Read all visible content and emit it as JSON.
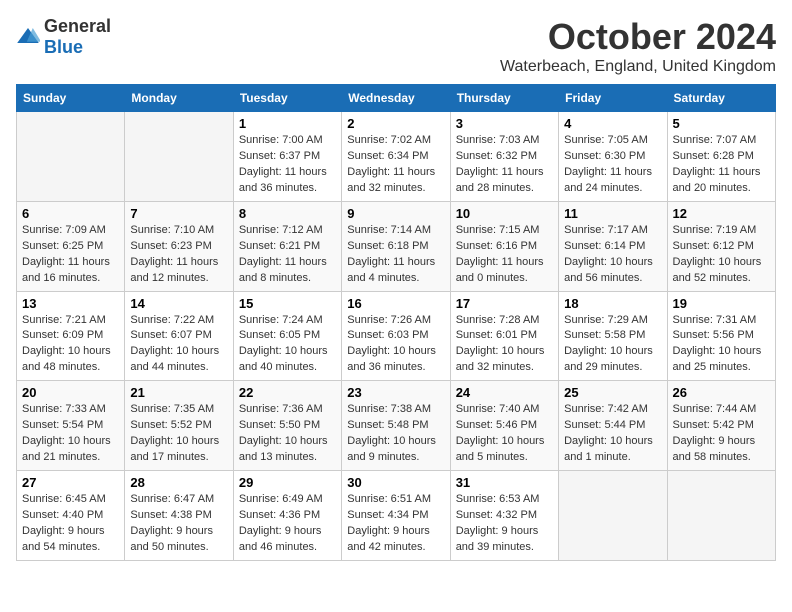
{
  "logo": {
    "general": "General",
    "blue": "Blue"
  },
  "title": "October 2024",
  "location": "Waterbeach, England, United Kingdom",
  "headers": [
    "Sunday",
    "Monday",
    "Tuesday",
    "Wednesday",
    "Thursday",
    "Friday",
    "Saturday"
  ],
  "weeks": [
    [
      {
        "day": "",
        "content": ""
      },
      {
        "day": "",
        "content": ""
      },
      {
        "day": "1",
        "content": "Sunrise: 7:00 AM\nSunset: 6:37 PM\nDaylight: 11 hours and 36 minutes."
      },
      {
        "day": "2",
        "content": "Sunrise: 7:02 AM\nSunset: 6:34 PM\nDaylight: 11 hours and 32 minutes."
      },
      {
        "day": "3",
        "content": "Sunrise: 7:03 AM\nSunset: 6:32 PM\nDaylight: 11 hours and 28 minutes."
      },
      {
        "day": "4",
        "content": "Sunrise: 7:05 AM\nSunset: 6:30 PM\nDaylight: 11 hours and 24 minutes."
      },
      {
        "day": "5",
        "content": "Sunrise: 7:07 AM\nSunset: 6:28 PM\nDaylight: 11 hours and 20 minutes."
      }
    ],
    [
      {
        "day": "6",
        "content": "Sunrise: 7:09 AM\nSunset: 6:25 PM\nDaylight: 11 hours and 16 minutes."
      },
      {
        "day": "7",
        "content": "Sunrise: 7:10 AM\nSunset: 6:23 PM\nDaylight: 11 hours and 12 minutes."
      },
      {
        "day": "8",
        "content": "Sunrise: 7:12 AM\nSunset: 6:21 PM\nDaylight: 11 hours and 8 minutes."
      },
      {
        "day": "9",
        "content": "Sunrise: 7:14 AM\nSunset: 6:18 PM\nDaylight: 11 hours and 4 minutes."
      },
      {
        "day": "10",
        "content": "Sunrise: 7:15 AM\nSunset: 6:16 PM\nDaylight: 11 hours and 0 minutes."
      },
      {
        "day": "11",
        "content": "Sunrise: 7:17 AM\nSunset: 6:14 PM\nDaylight: 10 hours and 56 minutes."
      },
      {
        "day": "12",
        "content": "Sunrise: 7:19 AM\nSunset: 6:12 PM\nDaylight: 10 hours and 52 minutes."
      }
    ],
    [
      {
        "day": "13",
        "content": "Sunrise: 7:21 AM\nSunset: 6:09 PM\nDaylight: 10 hours and 48 minutes."
      },
      {
        "day": "14",
        "content": "Sunrise: 7:22 AM\nSunset: 6:07 PM\nDaylight: 10 hours and 44 minutes."
      },
      {
        "day": "15",
        "content": "Sunrise: 7:24 AM\nSunset: 6:05 PM\nDaylight: 10 hours and 40 minutes."
      },
      {
        "day": "16",
        "content": "Sunrise: 7:26 AM\nSunset: 6:03 PM\nDaylight: 10 hours and 36 minutes."
      },
      {
        "day": "17",
        "content": "Sunrise: 7:28 AM\nSunset: 6:01 PM\nDaylight: 10 hours and 32 minutes."
      },
      {
        "day": "18",
        "content": "Sunrise: 7:29 AM\nSunset: 5:58 PM\nDaylight: 10 hours and 29 minutes."
      },
      {
        "day": "19",
        "content": "Sunrise: 7:31 AM\nSunset: 5:56 PM\nDaylight: 10 hours and 25 minutes."
      }
    ],
    [
      {
        "day": "20",
        "content": "Sunrise: 7:33 AM\nSunset: 5:54 PM\nDaylight: 10 hours and 21 minutes."
      },
      {
        "day": "21",
        "content": "Sunrise: 7:35 AM\nSunset: 5:52 PM\nDaylight: 10 hours and 17 minutes."
      },
      {
        "day": "22",
        "content": "Sunrise: 7:36 AM\nSunset: 5:50 PM\nDaylight: 10 hours and 13 minutes."
      },
      {
        "day": "23",
        "content": "Sunrise: 7:38 AM\nSunset: 5:48 PM\nDaylight: 10 hours and 9 minutes."
      },
      {
        "day": "24",
        "content": "Sunrise: 7:40 AM\nSunset: 5:46 PM\nDaylight: 10 hours and 5 minutes."
      },
      {
        "day": "25",
        "content": "Sunrise: 7:42 AM\nSunset: 5:44 PM\nDaylight: 10 hours and 1 minute."
      },
      {
        "day": "26",
        "content": "Sunrise: 7:44 AM\nSunset: 5:42 PM\nDaylight: 9 hours and 58 minutes."
      }
    ],
    [
      {
        "day": "27",
        "content": "Sunrise: 6:45 AM\nSunset: 4:40 PM\nDaylight: 9 hours and 54 minutes."
      },
      {
        "day": "28",
        "content": "Sunrise: 6:47 AM\nSunset: 4:38 PM\nDaylight: 9 hours and 50 minutes."
      },
      {
        "day": "29",
        "content": "Sunrise: 6:49 AM\nSunset: 4:36 PM\nDaylight: 9 hours and 46 minutes."
      },
      {
        "day": "30",
        "content": "Sunrise: 6:51 AM\nSunset: 4:34 PM\nDaylight: 9 hours and 42 minutes."
      },
      {
        "day": "31",
        "content": "Sunrise: 6:53 AM\nSunset: 4:32 PM\nDaylight: 9 hours and 39 minutes."
      },
      {
        "day": "",
        "content": ""
      },
      {
        "day": "",
        "content": ""
      }
    ]
  ]
}
